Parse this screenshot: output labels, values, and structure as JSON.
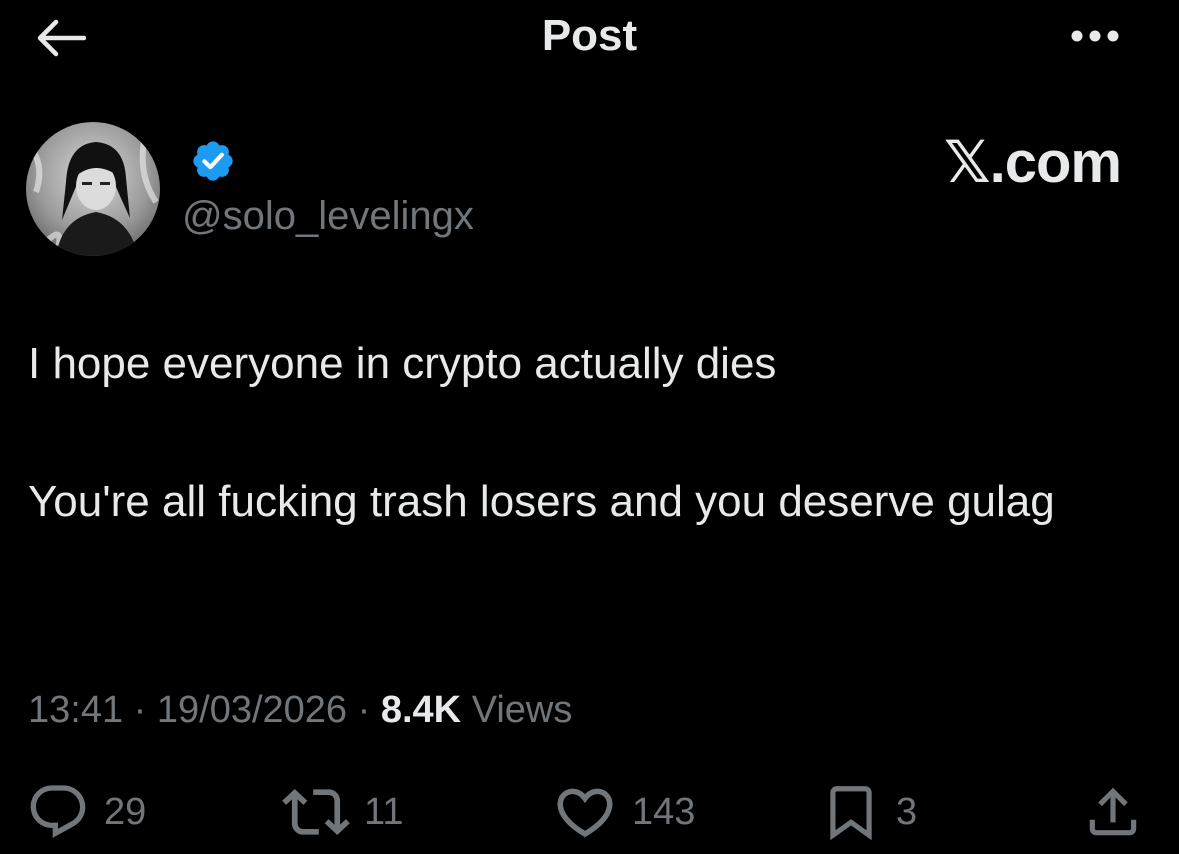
{
  "header": {
    "title": "Post",
    "back_icon": "arrow-left-icon",
    "more_icon": "more-horizontal-icon"
  },
  "author": {
    "handle": "@solo_levelingx",
    "verified_icon": "verified-badge-icon",
    "verified_color": "#1d9bf0"
  },
  "watermark": "𝕏.com",
  "tweet": {
    "paragraphs": [
      "I hope everyone in crypto actually dies",
      "You're all fucking trash losers and you deserve gulag"
    ],
    "time": "13:41",
    "date": "19/03/2026",
    "separator": "·",
    "views_count": "8.4K",
    "views_label": "Views"
  },
  "actions": {
    "replies": "29",
    "reposts": "11",
    "likes": "143",
    "bookmarks": "3"
  },
  "colors": {
    "background": "#000000",
    "text_primary": "#e7e9ea",
    "text_secondary": "#71767b"
  }
}
